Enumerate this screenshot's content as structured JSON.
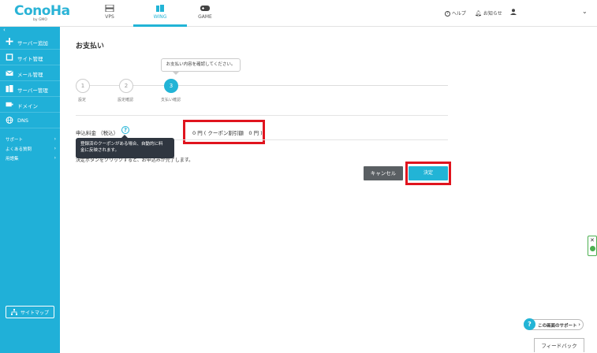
{
  "header": {
    "logo_text": "ConoHa",
    "logo_sub": "by GMO",
    "tabs": [
      {
        "label": "VPS",
        "icon": "server-icon",
        "active": false
      },
      {
        "label": "WING",
        "icon": "building-icon",
        "active": true
      },
      {
        "label": "GAME",
        "icon": "gamepad-icon",
        "active": false
      }
    ],
    "help_label": "ヘルプ",
    "notice_label": "お知らせ",
    "user_icon": "user-icon"
  },
  "sidebar": {
    "collapse_glyph": "‹",
    "items": [
      {
        "label": "サーバー追加",
        "icon": "plus-icon"
      },
      {
        "label": "サイト管理",
        "icon": "square-icon"
      },
      {
        "label": "メール管理",
        "icon": "mail-icon"
      },
      {
        "label": "サーバー管理",
        "icon": "server-stack-icon"
      },
      {
        "label": "ドメイン",
        "icon": "domain-icon"
      },
      {
        "label": "DNS",
        "icon": "globe-icon"
      }
    ],
    "links": [
      {
        "label": "サポート"
      },
      {
        "label": "よくある質問"
      },
      {
        "label": "用語集"
      }
    ],
    "sitemap_label": "サイトマップ"
  },
  "main": {
    "title": "お支払い",
    "step_tooltip": "お支払い内容を確認してください。",
    "steps": [
      {
        "number": "1",
        "label": "設定",
        "active": false
      },
      {
        "number": "2",
        "label": "設定確認",
        "active": false
      },
      {
        "number": "3",
        "label": "支払い確認",
        "active": true
      }
    ],
    "fee_label": "申込料金 （税込）",
    "fee_value": "0 円 ( クーポン割引額　0 円 )",
    "coupon_tip_line1": "登録済のクーポンがある場合、自動的に料",
    "coupon_tip_line2": "金に反映されます。",
    "confirm_note": "決定ボタンをクリックすると、お申込みが完了します。",
    "cancel_label": "キャンセル",
    "decide_label": "決定"
  },
  "widgets": {
    "support_label": "この画面のサポート",
    "feedback_label": "フィードバック"
  },
  "colors": {
    "accent": "#22b4d6",
    "sidebar": "#20b0d8",
    "highlight": "#e0141e",
    "cancel": "#5a5f63"
  }
}
